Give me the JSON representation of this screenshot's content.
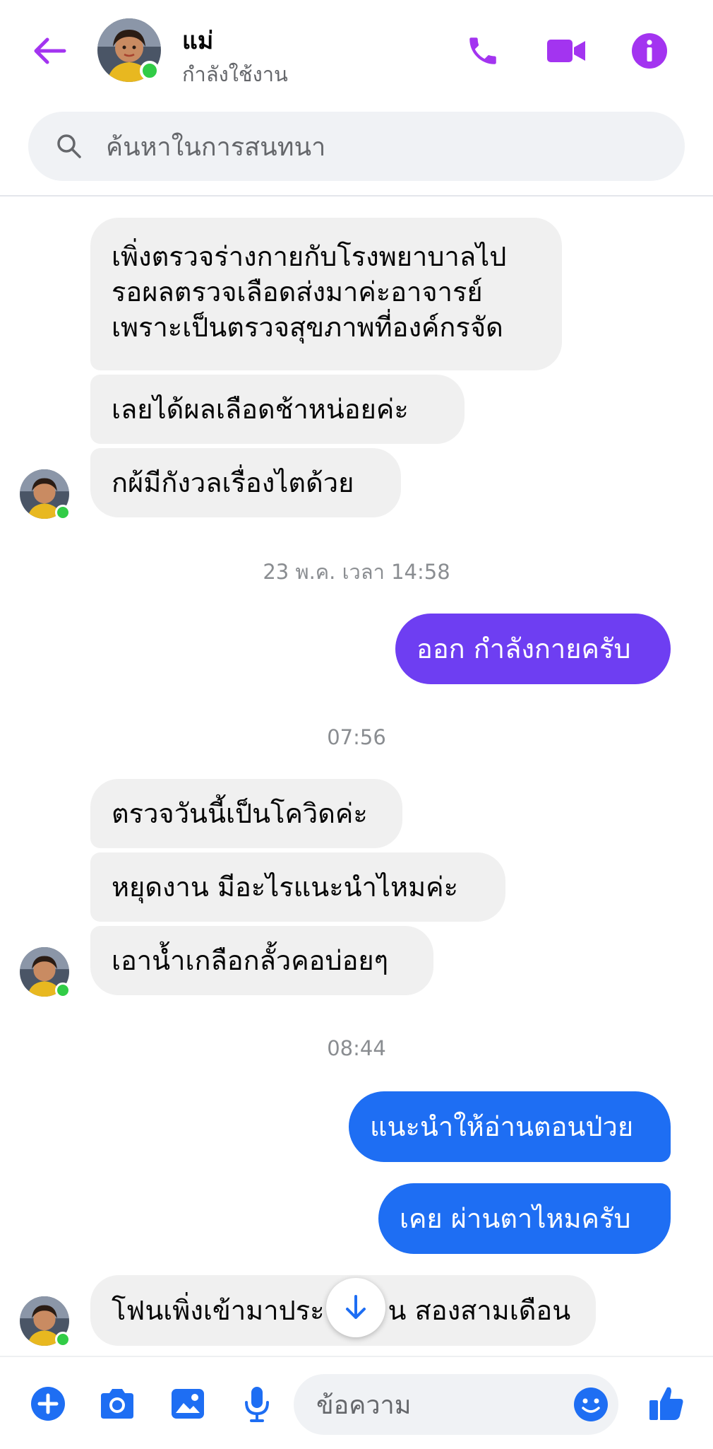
{
  "header": {
    "contact_name": "แม่",
    "status": "กำลังใช้งาน"
  },
  "search": {
    "placeholder": "ค้นหาในการสนทนา"
  },
  "messages": {
    "m1": "เพิ่งตรวจร่างกายกับโรงพยาบาลไป",
    "m2": "รอผลตรวจเลือดส่งมาค่ะอาจารย์",
    "m3": "เพราะเป็นตรวจสุขภาพที่องค์กรจัด",
    "m4": "เลยได้ผลเลือดช้าหน่อยค่ะ",
    "m5": "กผ้มีกังวลเรื่องไตด้วย",
    "ts1": "23 พ.ค. เวลา 14:58",
    "m6": "ออก กำลังกายครับ",
    "ts2": "07:56",
    "m7": "ตรวจวันนี้เป็นโควิดค่ะ",
    "m8": "หยุดงาน  มีอะไรแนะนำไหมค่ะ",
    "m9": "เอาน้ำเกลือกลั้วคอบ่อยๆ",
    "ts3": "08:44",
    "m10": "แนะนำให้อ่านตอนป่วย",
    "m11": "เคย ผ่านตาไหมครับ",
    "m12": "โฟนเพิ่งเข้ามาประ",
    "m12b": "น สองสามเดือน"
  },
  "composer": {
    "placeholder": "ข้อความ"
  },
  "colors": {
    "accent": "#a334f0",
    "outgoing_purple": "#6e3ef2",
    "outgoing_blue": "#1e6ef3",
    "incoming": "#f0f0f0",
    "online": "#31cc46"
  },
  "icons": [
    "back-arrow-icon",
    "phone-icon",
    "video-call-icon",
    "info-icon",
    "search-icon",
    "scroll-down-icon",
    "plus-icon",
    "camera-icon",
    "gallery-icon",
    "microphone-icon",
    "emoji-icon",
    "thumbs-up-icon"
  ]
}
